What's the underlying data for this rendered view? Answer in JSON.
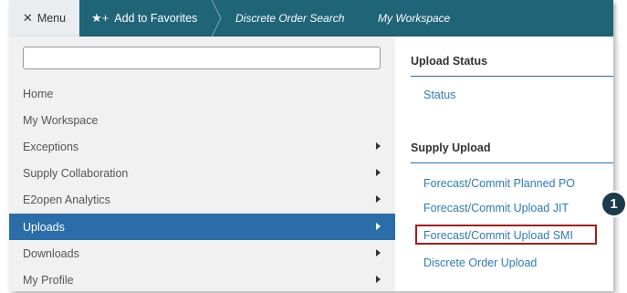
{
  "topbar": {
    "menu_icon": "✕",
    "menu_label": "Menu",
    "favorites_icon": "★+",
    "favorites_label": "Add to Favorites",
    "breadcrumbs": [
      "Discrete Order Search",
      "My Workspace"
    ]
  },
  "sidebar": {
    "search_placeholder": "",
    "items": [
      {
        "label": "Home",
        "has_submenu": false
      },
      {
        "label": "My Workspace",
        "has_submenu": false
      },
      {
        "label": "Exceptions",
        "has_submenu": true
      },
      {
        "label": "Supply Collaboration",
        "has_submenu": true
      },
      {
        "label": "E2open Analytics",
        "has_submenu": true
      },
      {
        "label": "Uploads",
        "has_submenu": true,
        "active": true
      },
      {
        "label": "Downloads",
        "has_submenu": true
      },
      {
        "label": "My Profile",
        "has_submenu": true
      }
    ]
  },
  "submenu": {
    "sections": [
      {
        "title": "Upload Status",
        "links": [
          "Status"
        ]
      },
      {
        "title": "Supply Upload",
        "links": [
          "Forecast/Commit Planned PO",
          "Forecast/Commit Upload JIT",
          "Forecast/Commit Upload SMI",
          "Discrete Order Upload"
        ]
      }
    ]
  },
  "callout": {
    "number": "1"
  },
  "colors": {
    "topbar": "#1f6477",
    "active_item": "#2b6da9",
    "link": "#2f7ab9",
    "highlight_border": "#a61b1b",
    "callout": "#1b3a4a"
  }
}
